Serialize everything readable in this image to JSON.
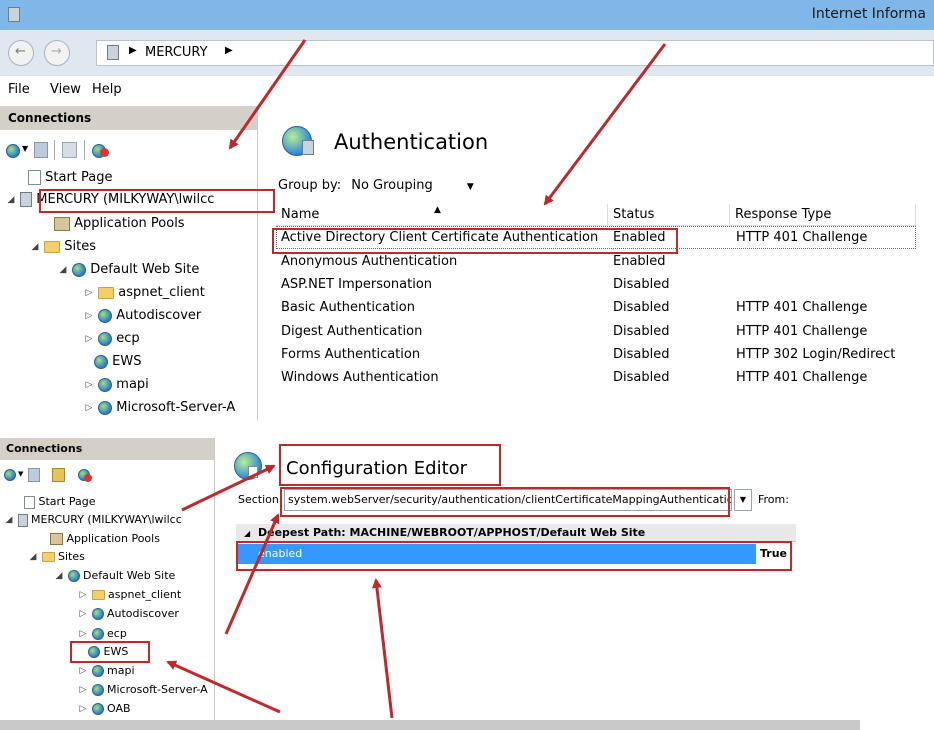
{
  "top_window": {
    "title": "Internet Informa",
    "breadcrumb": [
      "MERCURY"
    ],
    "menu": [
      "File",
      "View",
      "Help"
    ],
    "connections": {
      "header": "Connections",
      "tree": [
        {
          "label": "Start Page",
          "icon": "page-icon"
        },
        {
          "label": "MERCURY (MILKYWAY\\lwilcc",
          "icon": "server-icon"
        },
        {
          "label": "Application Pools",
          "icon": "app-pool-icon"
        },
        {
          "label": "Sites",
          "icon": "folder-icon"
        },
        {
          "label": "Default Web Site",
          "icon": "globe-icon"
        },
        {
          "label": "aspnet_client",
          "icon": "folder-icon"
        },
        {
          "label": "Autodiscover",
          "icon": "globe-icon"
        },
        {
          "label": "ecp",
          "icon": "globe-icon"
        },
        {
          "label": "EWS",
          "icon": "globe-icon"
        },
        {
          "label": "mapi",
          "icon": "globe-icon"
        },
        {
          "label": "Microsoft-Server-A",
          "icon": "globe-icon"
        }
      ]
    },
    "authentication": {
      "title": "Authentication",
      "group_by_label": "Group by:",
      "group_by_value": "No Grouping",
      "columns": [
        "Name",
        "Status",
        "Response Type"
      ],
      "rows": [
        {
          "name": "Active Directory Client Certificate Authentication",
          "status": "Enabled",
          "response": "HTTP 401 Challenge"
        },
        {
          "name": "Anonymous Authentication",
          "status": "Enabled",
          "response": ""
        },
        {
          "name": "ASP.NET Impersonation",
          "status": "Disabled",
          "response": ""
        },
        {
          "name": "Basic Authentication",
          "status": "Disabled",
          "response": "HTTP 401 Challenge"
        },
        {
          "name": "Digest Authentication",
          "status": "Disabled",
          "response": "HTTP 401 Challenge"
        },
        {
          "name": "Forms Authentication",
          "status": "Disabled",
          "response": "HTTP 302 Login/Redirect"
        },
        {
          "name": "Windows Authentication",
          "status": "Disabled",
          "response": "HTTP 401 Challenge"
        }
      ]
    }
  },
  "bottom_window": {
    "connections": {
      "header": "Connections",
      "tree": [
        {
          "label": "Start Page"
        },
        {
          "label": "MERCURY (MILKYWAY\\lwilcc"
        },
        {
          "label": "Application Pools"
        },
        {
          "label": "Sites"
        },
        {
          "label": "Default Web Site"
        },
        {
          "label": "aspnet_client"
        },
        {
          "label": "Autodiscover"
        },
        {
          "label": "ecp"
        },
        {
          "label": "EWS"
        },
        {
          "label": "mapi"
        },
        {
          "label": "Microsoft-Server-A"
        },
        {
          "label": "OAB"
        }
      ]
    },
    "config_editor": {
      "title": "Configuration Editor",
      "section_label": "Section:",
      "section_value": "system.webServer/security/authentication/clientCertificateMappingAuthenticatic",
      "from_label": "From:",
      "deepest_path": "Deepest Path: MACHINE/WEBROOT/APPHOST/Default Web Site",
      "property_name": "enabled",
      "property_value": "True"
    }
  },
  "colors": {
    "annotation_red": "#c0292b",
    "title_bar": "#7eb7e8",
    "selection_blue": "#3399ff"
  }
}
